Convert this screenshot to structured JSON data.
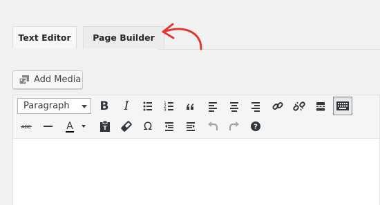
{
  "tabs": [
    {
      "label": "Text Editor",
      "active": true
    },
    {
      "label": "Page Builder",
      "active": false
    }
  ],
  "add_media": {
    "label": "Add Media",
    "icon": "add-media-icon"
  },
  "toolbar": {
    "format_select": {
      "value": "Paragraph"
    },
    "row1": [
      "bold",
      "italic",
      "bulleted-list",
      "numbered-list",
      "blockquote",
      "align-left",
      "align-center",
      "align-right",
      "insert-link",
      "remove-link",
      "read-more",
      "toolbar-toggle"
    ],
    "row2": [
      "strikethrough",
      "horizontal-line",
      "text-color",
      "paste-as-text",
      "clear-formatting",
      "special-character",
      "decrease-indent",
      "increase-indent",
      "undo",
      "redo",
      "keyboard-shortcuts"
    ],
    "glyphs": {
      "bold": "B",
      "italic": "I",
      "strike": "ABC",
      "text_color": "A",
      "omega": "Ω",
      "help": "?"
    },
    "active_button": "toolbar-toggle"
  },
  "colors": {
    "arrow": "#e5352f",
    "active_icon": "#32373c",
    "disabled_icon": "#a0a5aa",
    "text_color_underline": "#000000"
  },
  "editor": {
    "content": ""
  }
}
